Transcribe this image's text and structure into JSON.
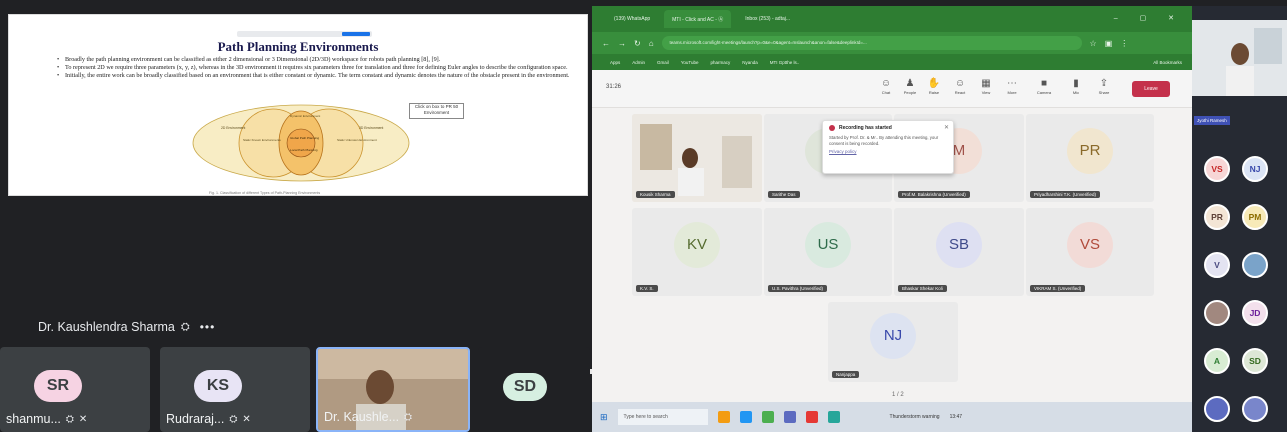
{
  "left": {
    "slide": {
      "title": "Path Planning Environments",
      "bullets": [
        "Broadly the path planning environment can be classified as either 2 dimensional or 3 Dimensional (2D/3D) workspace for robots path planning [8], [9].",
        "To represent 2D we require three parameters (x, y, z), whereas in the 3D environment it requires six parameters three for translation and three for defining Euler angles to describe the configuration space.",
        "Initially, the entire work can be broadly classified based on an environment that is either constant or dynamic. The term constant and dynamic denotes the nature of the obstacle present in the environment."
      ],
      "note": "Click on box to PR 50 Environment",
      "venn_labels": [
        "2D Environment",
        "Static Known Environments",
        "Global Path Planning",
        "Local Path Planning",
        "3D Environment",
        "Static Unknown Environment",
        "Dynamic Environment"
      ],
      "caption": "Fig. 1. Classification of different Types of Path-Planning Environments"
    },
    "presenter_name": "Dr. Kaushlendra Sharma",
    "tiles": [
      {
        "initials": "SR",
        "name": "shanmu...",
        "color": "#f6d3e3"
      },
      {
        "initials": "KS",
        "name": "Rudraraj...",
        "color": "#e8e4f5"
      },
      {
        "initials": "",
        "name": "Dr. Kaushle...",
        "color": ""
      },
      {
        "initials": "SD",
        "name": "",
        "color": "#d6efe1"
      }
    ]
  },
  "teams": {
    "tabs": [
      "(139) WhatsApp",
      "MTI - Click and AC - Ⓐ",
      "Inbox (253) - adtaj..."
    ],
    "url": "teams.microsoft.com/light-meetings/launch?p=0&e=0&agent=mslaunch&anon=false&deeplinkId=...",
    "bookmarks": [
      "Apps",
      "Admin",
      "Gmail",
      "YouTube",
      "pharmacy",
      "Nyanda",
      "MTI Gptthe ls..",
      "All Bookmarks"
    ],
    "timer": "31:26",
    "toolbar": [
      "Chat",
      "People",
      "Raise",
      "React",
      "View",
      "More",
      "Camera",
      "Mic",
      "Share"
    ],
    "leave_label": "Leave",
    "participants": [
      {
        "initials": "",
        "label": "Kousik Sharma",
        "bg": ""
      },
      {
        "initials": "S",
        "label": "Sarithe Das",
        "bg": "#dfe5da"
      },
      {
        "initials": "M",
        "label": "Prof.M. Balakrishna (Unverified)",
        "bg": "#f2dfd7"
      },
      {
        "initials": "PR",
        "label": "Priyadharshini T.K. (Unverified)",
        "bg": "#f1e6cf"
      },
      {
        "initials": "KV",
        "label": "K.V. S.",
        "bg": "#e3ead9"
      },
      {
        "initials": "US",
        "label": "U.S. Pavithra (Unverified)",
        "bg": "#d9eadf"
      },
      {
        "initials": "SB",
        "label": "Bhaskar Shekar Koli",
        "bg": "#dee0f2"
      },
      {
        "initials": "VS",
        "label": "VIKRAM S. (Unverified)",
        "bg": "#f2dbd7"
      },
      {
        "initials": "NJ",
        "label": "Nanjappa",
        "bg": "#dde3f1"
      }
    ],
    "recording": {
      "title": "Recording has started",
      "body": "Started by Prof. Dr. & Mr.. By attending this meeting, your consent is being recorded.",
      "link": "Privacy policy"
    },
    "pager": "1 / 2",
    "taskbar_search": "Type here to search",
    "weather": "Thunderstorm warning",
    "clock": "13:47"
  },
  "strip": {
    "name_tag": "Jyothi Ramesh",
    "avatars": [
      {
        "i": "VS",
        "bg": "#f7d6d6",
        "fg": "#c62828"
      },
      {
        "i": "NJ",
        "bg": "#dbe4f5",
        "fg": "#3949ab"
      },
      {
        "i": "PR",
        "bg": "#f3e5d5",
        "fg": "#5d4037"
      },
      {
        "i": "PM",
        "bg": "#f7eab8",
        "fg": "#8d6e00"
      },
      {
        "i": "V",
        "bg": "#e3e3f1",
        "fg": "#4a4a80"
      },
      {
        "i": "",
        "bg": "#7aa3c9",
        "fg": "#fff"
      },
      {
        "i": "",
        "bg": "#a1887f",
        "fg": "#fff"
      },
      {
        "i": "JD",
        "bg": "#f3e0ec",
        "fg": "#6a1b9a"
      },
      {
        "i": "A",
        "bg": "#d8ecd3",
        "fg": "#2e7d32"
      },
      {
        "i": "SD",
        "bg": "#dde7d6",
        "fg": "#33691e"
      },
      {
        "i": "",
        "bg": "#5c6bc0",
        "fg": "#fff"
      },
      {
        "i": "",
        "bg": "#7986cb",
        "fg": "#fff"
      }
    ]
  },
  "colors": {
    "meet_bg": "#202124",
    "teams_header": "#2e7d32",
    "leave": "#c4314b"
  }
}
